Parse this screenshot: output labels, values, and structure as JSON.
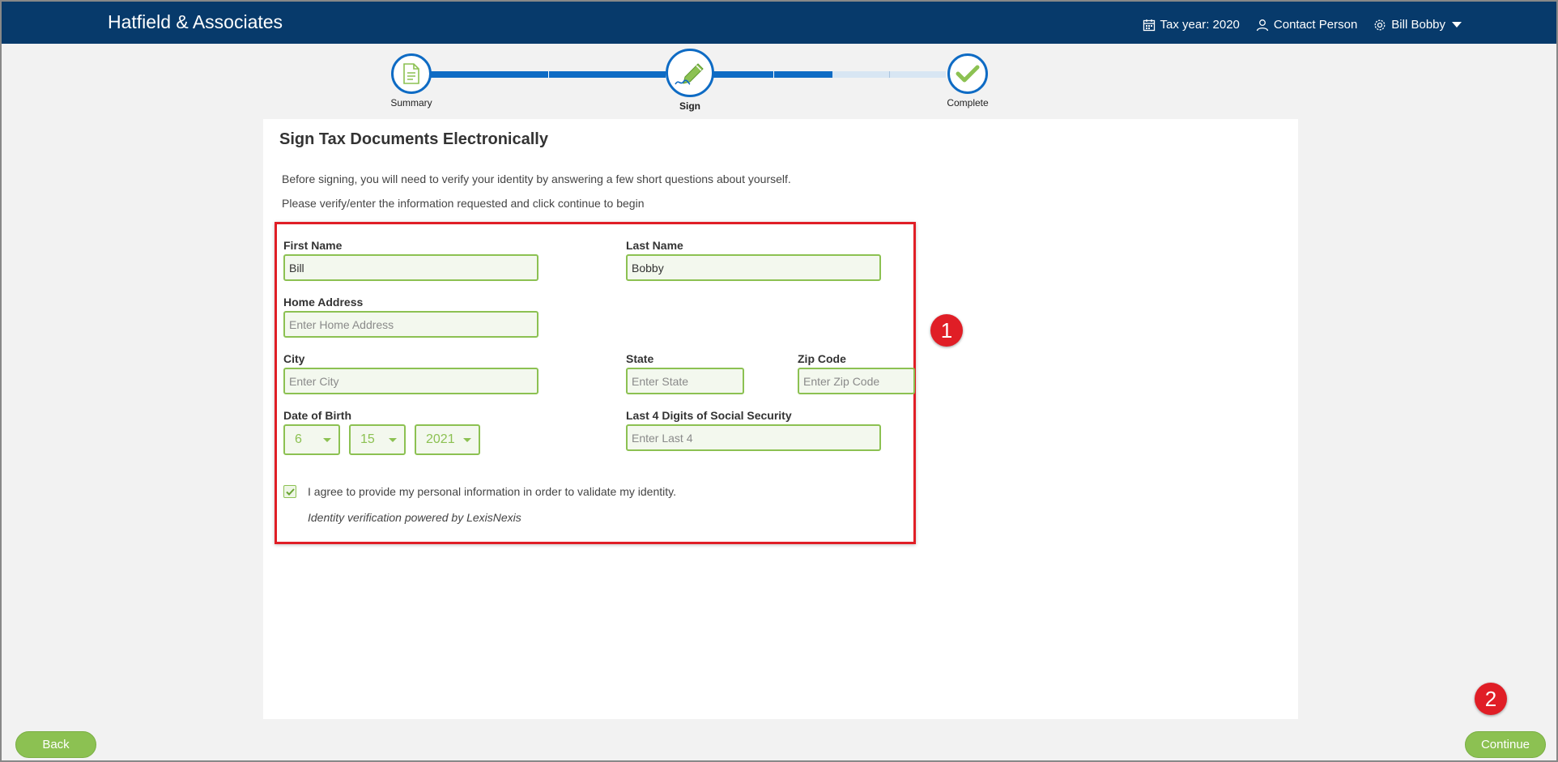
{
  "header": {
    "brand": "Hatfield & Associates",
    "tax_year": "Tax year: 2020",
    "contact": "Contact Person",
    "user": "Bill Bobby"
  },
  "progress": {
    "steps": [
      {
        "label": "Summary",
        "icon": "document-icon"
      },
      {
        "label": "Sign",
        "icon": "pen-icon"
      },
      {
        "label": "Complete",
        "icon": "checkmark-icon"
      }
    ],
    "colors": {
      "done": "#0e6bc4",
      "pending": "#d8e6f3"
    }
  },
  "page": {
    "title": "Sign Tax Documents Electronically",
    "intro_1": "Before signing, you will need to verify your identity by answering a few short questions about yourself.",
    "intro_2": "Please verify/enter the information requested and click continue to begin"
  },
  "form": {
    "first_name": {
      "label": "First Name",
      "value": "Bill"
    },
    "last_name": {
      "label": "Last Name",
      "value": "Bobby"
    },
    "home_address": {
      "label": "Home Address",
      "placeholder": "Enter Home Address"
    },
    "city": {
      "label": "City",
      "placeholder": "Enter City"
    },
    "state": {
      "label": "State",
      "placeholder": "Enter State"
    },
    "zip": {
      "label": "Zip Code",
      "placeholder": "Enter Zip Code"
    },
    "dob": {
      "label": "Date of Birth",
      "month": "6",
      "day": "15",
      "year": "2021"
    },
    "ssn": {
      "label": "Last 4 Digits of Social Security",
      "placeholder": "Enter Last 4"
    },
    "agree": "I agree to provide my personal information in order to validate my identity.",
    "agree_checked": true,
    "powered_by": "Identity verification powered by LexisNexis"
  },
  "callouts": {
    "one": "1",
    "two": "2"
  },
  "buttons": {
    "back": "Back",
    "continue": "Continue"
  },
  "colors": {
    "header": "#073a6b",
    "accent_green": "#8cc152",
    "callout_red": "#e01e26"
  }
}
